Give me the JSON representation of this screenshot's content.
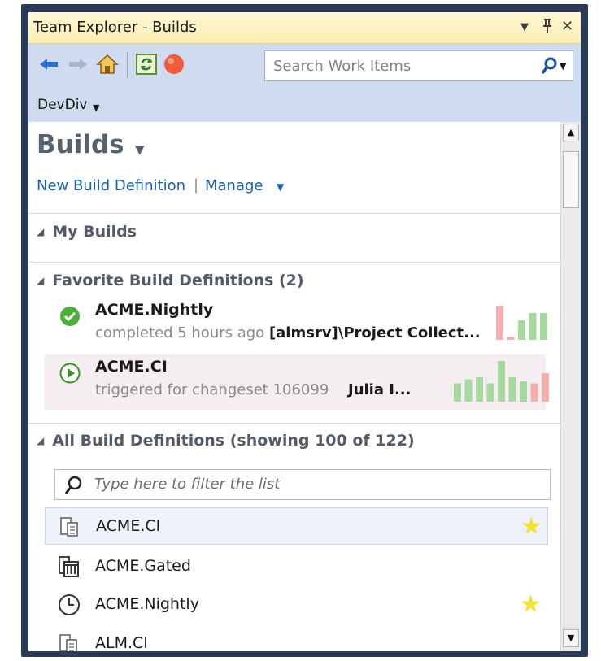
{
  "window": {
    "title": "Team Explorer - Builds"
  },
  "toolbar": {
    "search_placeholder": "Search Work Items"
  },
  "project": {
    "name": "DevDiv"
  },
  "page": {
    "title": "Builds"
  },
  "links": {
    "new_definition": "New Build Definition",
    "separator": "|",
    "manage": "Manage"
  },
  "sections": {
    "my_builds": "My Builds",
    "favorites": "Favorite Build Definitions (2)",
    "all": "All Build Definitions (showing 100 of 122)"
  },
  "favorites": [
    {
      "name": "ACME.Nightly",
      "status_text": "completed 5 hours ago",
      "requested_by": "[almsrv]\\Project Collect...",
      "status_icon": "check-icon",
      "history": [
        {
          "h": 0.95,
          "c": "#f2b0b0"
        },
        {
          "h": 0.08,
          "c": "#f2b0b0"
        },
        {
          "h": 0.55,
          "c": "#a6d8a0"
        },
        {
          "h": 0.75,
          "c": "#a6d8a0"
        },
        {
          "h": 0.75,
          "c": "#a6d8a0"
        }
      ]
    },
    {
      "name": "ACME.CI",
      "status_text": "triggered for changeset 106099",
      "requested_by": "Julia I...",
      "status_icon": "play-icon",
      "history": [
        {
          "h": 0.45,
          "c": "#a6d8a0"
        },
        {
          "h": 0.55,
          "c": "#a6d8a0"
        },
        {
          "h": 0.6,
          "c": "#a6d8a0"
        },
        {
          "h": 0.45,
          "c": "#a6d8a0"
        },
        {
          "h": 1.0,
          "c": "#a6d8a0"
        },
        {
          "h": 0.6,
          "c": "#a6d8a0"
        },
        {
          "h": 0.5,
          "c": "#a6d8a0"
        },
        {
          "h": 0.45,
          "c": "#f2b0b0"
        },
        {
          "h": 0.7,
          "c": "#f2b0b0"
        }
      ]
    }
  ],
  "filter": {
    "placeholder": "Type here to filter the list"
  },
  "definitions": [
    {
      "name": "ACME.CI",
      "icon": "build-definition-icon",
      "favorite": true
    },
    {
      "name": "ACME.Gated",
      "icon": "gated-build-icon",
      "favorite": false
    },
    {
      "name": "ACME.Nightly",
      "icon": "clock-icon",
      "favorite": true
    },
    {
      "name": "ALM.CI",
      "icon": "build-definition-icon",
      "favorite": false
    }
  ],
  "colors": {
    "link": "#1e5fa8",
    "star": "#f1e239",
    "success": "#4caf3c"
  }
}
